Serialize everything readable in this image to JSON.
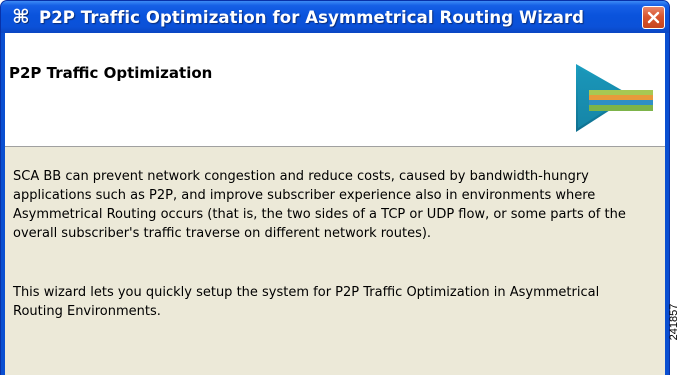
{
  "window": {
    "title": "P2P Traffic Optimization for Asymmetrical Routing Wizard",
    "app_icon": "command-key-icon",
    "close_icon": "close-icon"
  },
  "header": {
    "title": "P2P Traffic Optimization",
    "graphic": "wizard-arrow-graphic"
  },
  "content": {
    "intro": "SCA BB can prevent network congestion and reduce costs, caused by bandwidth-hungry applications such as P2P, and improve subscriber experience also in environments where Asymmetrical Routing occurs (that is, the two sides of a TCP or UDP flow, or some parts of the overall subscriber's traffic traverse on different network routes).",
    "wizard_description": "This wizard lets you quickly setup the system for P2P Traffic Optimization in Asymmetrical Routing Environments."
  },
  "figure_id": "241857",
  "colors": {
    "titlebar": "#0a53dc",
    "frame": "#0a4fd1",
    "close_button": "#d8552f",
    "content_background": "#ece9d8",
    "header_background": "#ffffff"
  }
}
